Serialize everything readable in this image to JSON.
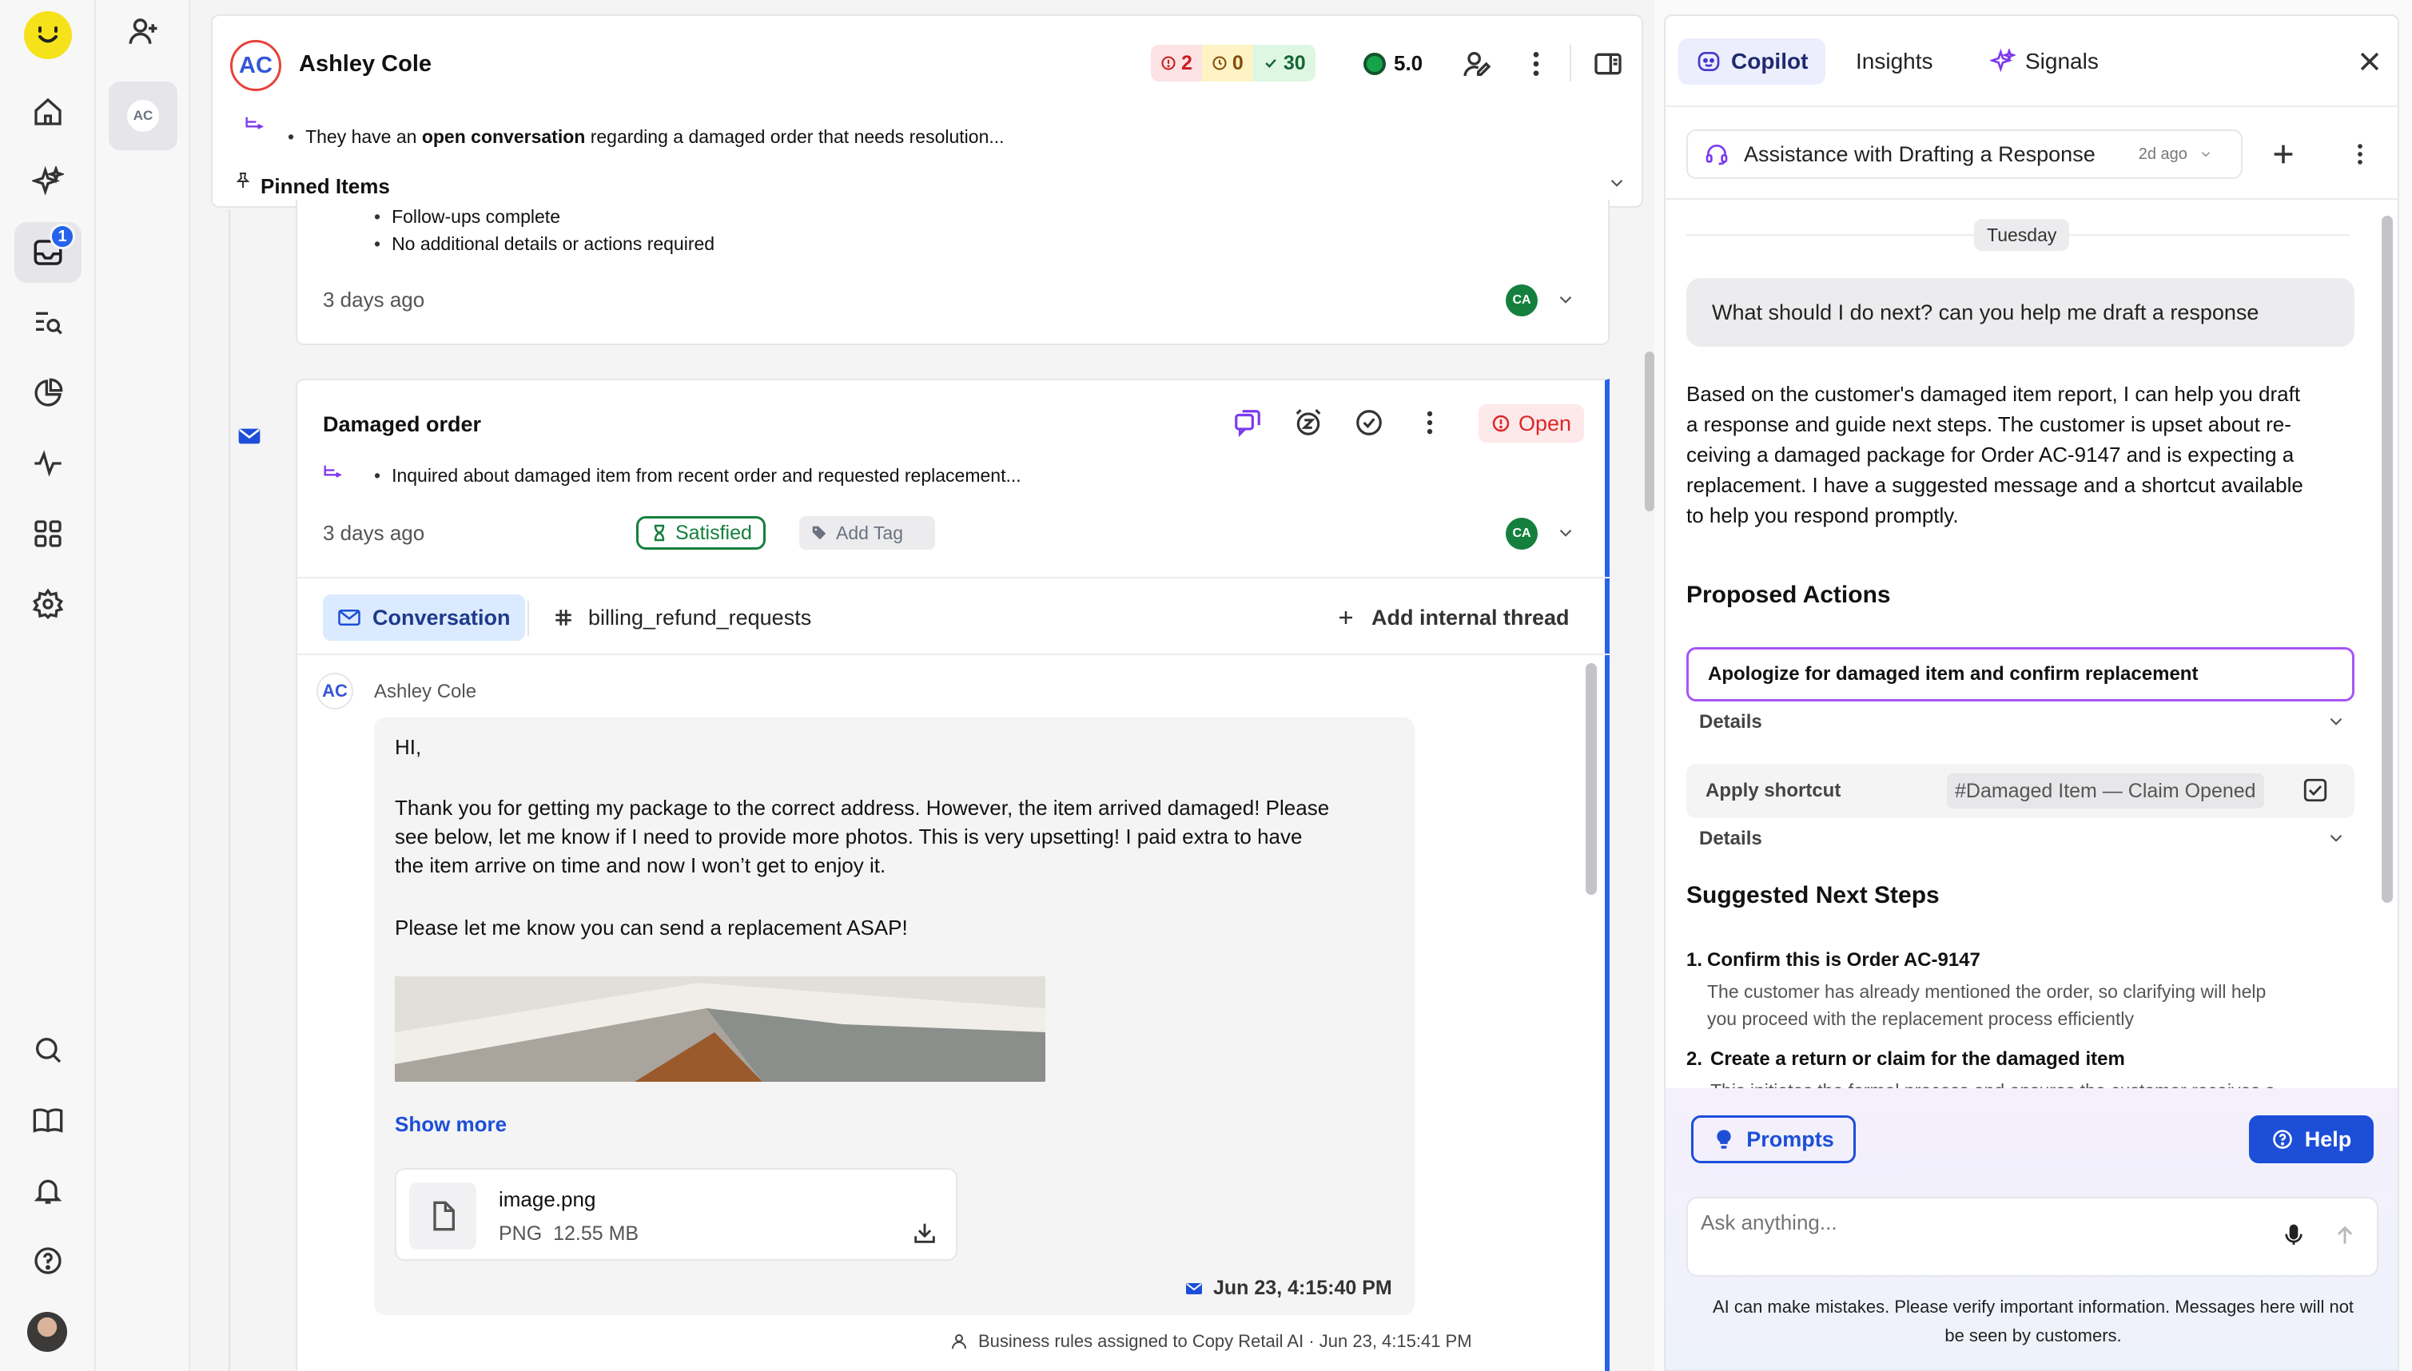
{
  "rail": {
    "inbox_badge": "1"
  },
  "col2": {
    "contact_initials": "AC"
  },
  "header": {
    "initials": "AC",
    "name": "Ashley Cole",
    "chip_red": "2",
    "chip_yellow": "0",
    "chip_green": "30",
    "score": "5.0",
    "summary_pre": "They have an ",
    "summary_bold": "open conversation",
    "summary_post": " regarding a damaged order that needs resolution...",
    "pinned_label": "Pinned Items"
  },
  "prev_card": {
    "bullets": [
      "Follow-ups complete",
      "No additional details or actions required"
    ],
    "time": "3 days ago",
    "assignee": "CA"
  },
  "ticket": {
    "title": "Damaged order",
    "status": "Open",
    "summary": "Inquired about damaged item from recent order and requested replacement...",
    "time": "3 days ago",
    "satisfaction": "Satisfied",
    "add_tag": "Add Tag",
    "assignee": "CA",
    "tabs": {
      "conversation": "Conversation",
      "channel": "billing_refund_requests",
      "add_thread": "Add internal thread"
    }
  },
  "message": {
    "initials": "AC",
    "sender": "Ashley Cole",
    "greeting": "HI,",
    "para1_l1": "Thank you for getting my package to the correct address. However, the item arrived damaged! Please",
    "para1_l2": "see below, let me know if I need to provide more photos. This is very upsetting! I paid extra to have",
    "para1_l3": "the item arrive on time and now I won’t get to enjoy it.",
    "para2": "Please let me know you can send a replacement ASAP!",
    "show_more": "Show more",
    "attachment_name": "image.png",
    "attachment_type": "PNG",
    "attachment_size": "12.55 MB",
    "timestamp": "Jun 23, 4:15:40 PM",
    "rules_note": "Business rules assigned to Copy Retail AI · Jun 23, 4:15:41 PM"
  },
  "copilot": {
    "tabs": [
      "Copilot",
      "Insights",
      "Signals"
    ],
    "thread_title": "Assistance with Drafting a Response",
    "thread_age": "2d ago",
    "day_divider": "Tuesday",
    "user_message": "What should I do next? can you help me draft a response",
    "reply_lines": [
      "Based on the customer's damaged item report, I can help you draft",
      "a response and guide next steps. The customer is upset about re-",
      "ceiving a damaged package for Order AC-9147 and is expecting a",
      "replacement. I have a suggested message and a shortcut available",
      "to help you respond promptly."
    ],
    "proposed_title": "Proposed Actions",
    "action1": "Apologize for damaged item and confirm replacement",
    "details1": "Details",
    "action2_label": "Apply shortcut",
    "action2_value": "#Damaged Item — Claim Opened",
    "details2": "Details",
    "steps_title": "Suggested Next Steps",
    "steps": [
      {
        "n": "1.",
        "title": "Confirm this is Order AC-9147",
        "l1": "The customer has already mentioned the order, so clarifying will help",
        "l2": "you proceed with the replacement process efficiently"
      },
      {
        "n": "2.",
        "title": "Create a return or claim for the damaged item",
        "l1": "This initiates the formal process and ensures the customer receives a",
        "l2": ""
      }
    ],
    "prompts_label": "Prompts",
    "help_label": "Help",
    "ask_placeholder": "Ask anything...",
    "disclaimer_l1": "AI can make mistakes. Please verify important information. Messages here will not",
    "disclaimer_l2": "be seen by customers."
  },
  "colors": {
    "accent": "#1d4ed8",
    "open_red": "#dc2626",
    "satisfied_green": "#15803d",
    "ticket_border": "#2563eb"
  }
}
